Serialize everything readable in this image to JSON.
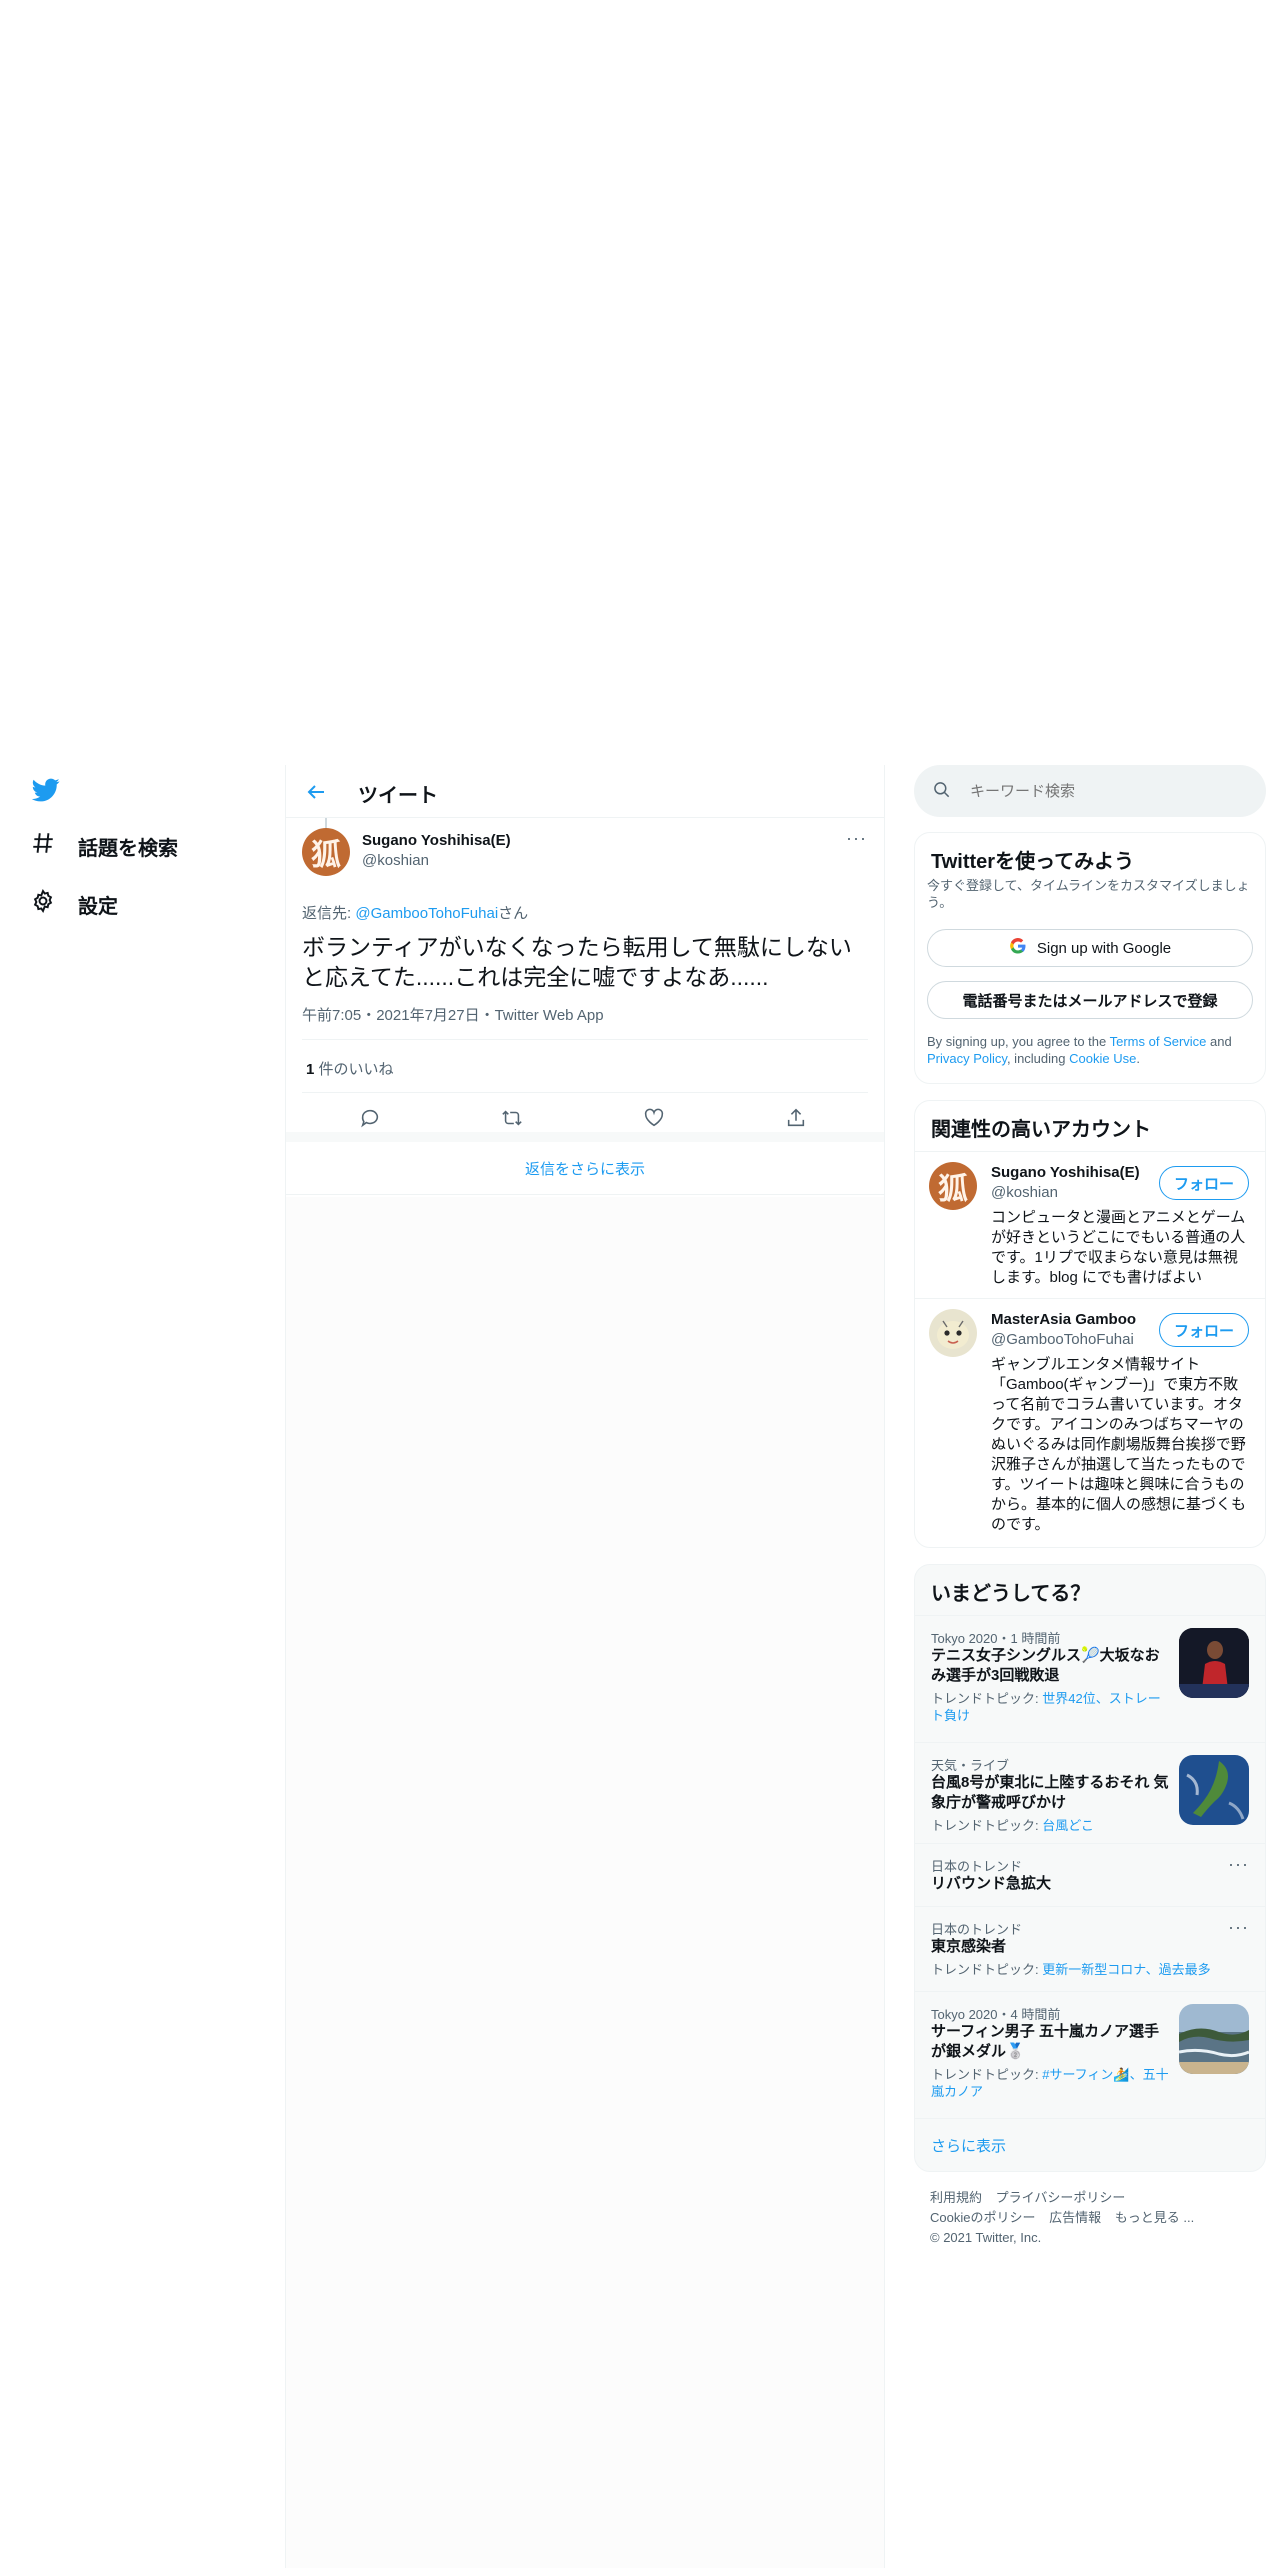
{
  "nav": {
    "explore_label": "話題を検索",
    "settings_label": "設定"
  },
  "main": {
    "header_title": "ツイート",
    "tweet": {
      "display_name": "Sugano Yoshihisa(E)",
      "handle": "@koshian",
      "avatar_glyph": "狐",
      "reply_prefix": "返信先: ",
      "reply_to": "@GambooTohoFuhai",
      "reply_suffix": "さん",
      "text": "ボランティアがいなくなったら転用して無駄にしないと応えてた......これは完全に嘘ですよなあ......",
      "timestamp": "午前7:05・2021年7月27日・Twitter Web App",
      "like_count": "1",
      "like_label": " 件のいいね"
    },
    "show_more_replies": "返信をさらに表示"
  },
  "sidebar": {
    "search_placeholder": "キーワード検索",
    "signup": {
      "title": "Twitterを使ってみよう",
      "subtitle": "今すぐ登録して、タイムラインをカスタマイズしましょう。",
      "google_button": "Sign up with Google",
      "phone_button": "電話番号またはメールアドレスで登録",
      "terms_prefix": "By signing up, you agree to the ",
      "terms_link": "Terms of Service",
      "terms_and": " and ",
      "privacy_link": "Privacy Policy",
      "terms_including": ", including ",
      "cookie_link": "Cookie Use",
      "terms_end": "."
    },
    "related": {
      "title": "関連性の高いアカウント",
      "follow_label": "フォロー",
      "accounts": [
        {
          "name": "Sugano Yoshihisa(E)",
          "handle": "@koshian",
          "bio": "コンピュータと漫画とアニメとゲームが好きというどこにでもいる普通の人です。1リプで収まらない意見は無視します。blog にでも書けばよい"
        },
        {
          "name": "MasterAsia Gamboo",
          "handle": "@GambooTohoFuhai",
          "bio": "ギャンブルエンタメ情報サイト「Gamboo(ギャンブー)」で東方不敗って名前でコラム書いています。オタクです。アイコンのみつばちマーヤのぬいぐるみは同作劇場版舞台挨拶で野沢雅子さんが抽選して当たったものです。ツイートは趣味と興味に合うものから。基本的に個人の感想に基づくものです。"
        }
      ]
    },
    "trends": {
      "title": "いまどうしてる？",
      "items": [
        {
          "meta": "Tokyo 2020・1 時間前",
          "title": "テニス女子シングルス🎾大坂なおみ選手が3回戦敗退",
          "topic_prefix": "トレンドトピック: ",
          "topic_links": "世界42位、ストレート負け"
        },
        {
          "meta": "天気・ライブ",
          "title": "台風8号が東北に上陸するおそれ 気象庁が警戒呼びかけ",
          "topic_prefix": "トレンドトピック: ",
          "topic_links": "台風どこ"
        },
        {
          "meta": "日本のトレンド",
          "title": "リバウンド急拡大"
        },
        {
          "meta": "日本のトレンド",
          "title": "東京感染者",
          "topic_prefix": "トレンドトピック: ",
          "topic_links": "更新一新型コロナ、過去最多"
        },
        {
          "meta": "Tokyo 2020・4 時間前",
          "title": "サーフィン男子 五十嵐カノア選手が銀メダル🥈",
          "topic_prefix": "トレンドトピック: ",
          "topic_links": "#サーフィン🏄、五十嵐カノア"
        }
      ],
      "show_more": "さらに表示"
    },
    "footer": {
      "links": [
        "利用規約",
        "プライバシーポリシー",
        "Cookieのポリシー",
        "広告情報",
        "もっと見る ..."
      ],
      "copyright": "© 2021 Twitter, Inc."
    }
  },
  "colors": {
    "accent": "#1d9bf0",
    "text": "#0f1419",
    "muted": "#536471"
  }
}
